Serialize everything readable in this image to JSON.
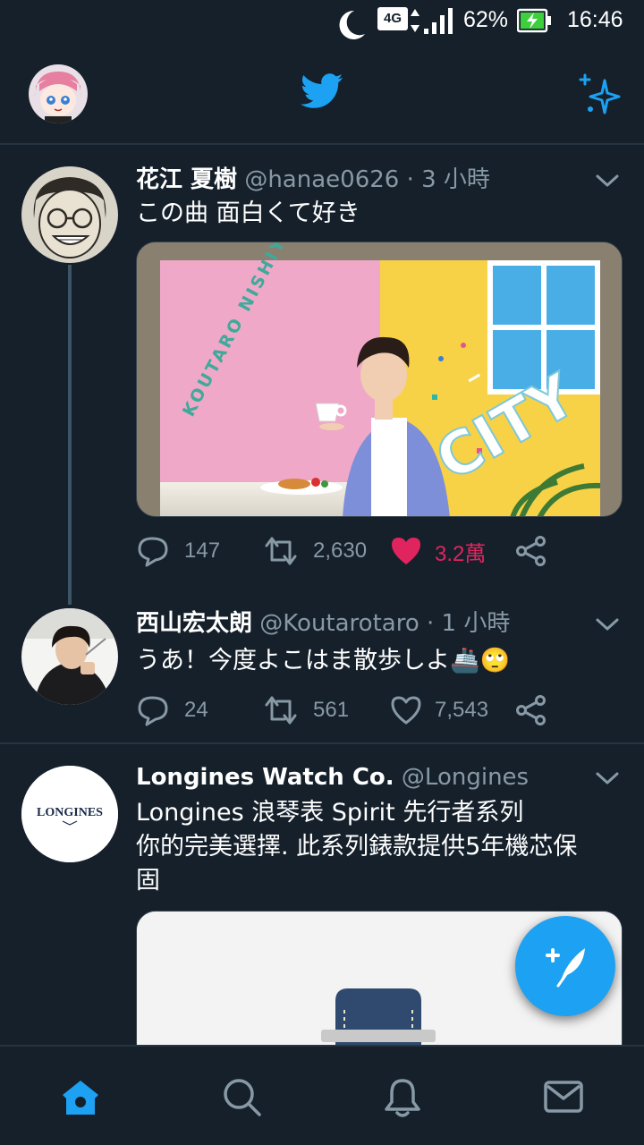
{
  "status_bar": {
    "network": "4G",
    "battery_percent": "62%",
    "time": "16:46",
    "icons": [
      "moon-icon",
      "signal-icon",
      "battery-charging-icon"
    ]
  },
  "header": {
    "icons": [
      "profile-avatar",
      "twitter-bird-icon",
      "sparkle-icon"
    ]
  },
  "tweets": [
    {
      "name": "花江 夏樹",
      "handle": "@hanae0626",
      "dot": "·",
      "time": "3 小時",
      "text": "この曲 面白くて好き",
      "media": {
        "vertical_text": "KOUTARO NISHIYAMA",
        "word": "CITY"
      },
      "replies": "147",
      "retweets": "2,630",
      "likes": "3.2萬",
      "liked": true
    },
    {
      "name": "西山宏太朗",
      "handle": "@Koutarotaro",
      "dot": "·",
      "time": "1 小時",
      "text": "うあ！今度よこはま散歩しよ🚢🙄",
      "replies": "24",
      "retweets": "561",
      "likes": "7,543",
      "liked": false
    },
    {
      "name": "Longines Watch Co.",
      "handle": "@Longines",
      "avatar_logo": "LONGINES",
      "text_lines": [
        "Longines 浪琴表 Spirit 先行者系列",
        "你的完美選擇. 此系列錶款提供5年機芯保",
        "固"
      ]
    }
  ],
  "bottom_nav": {
    "items": [
      "home-icon",
      "search-icon",
      "notifications-icon",
      "messages-icon"
    ],
    "active": "home-icon"
  },
  "colors": {
    "background": "#15202b",
    "accent": "#1da1f2",
    "like": "#e0245e",
    "secondary_text": "#8899a6"
  }
}
